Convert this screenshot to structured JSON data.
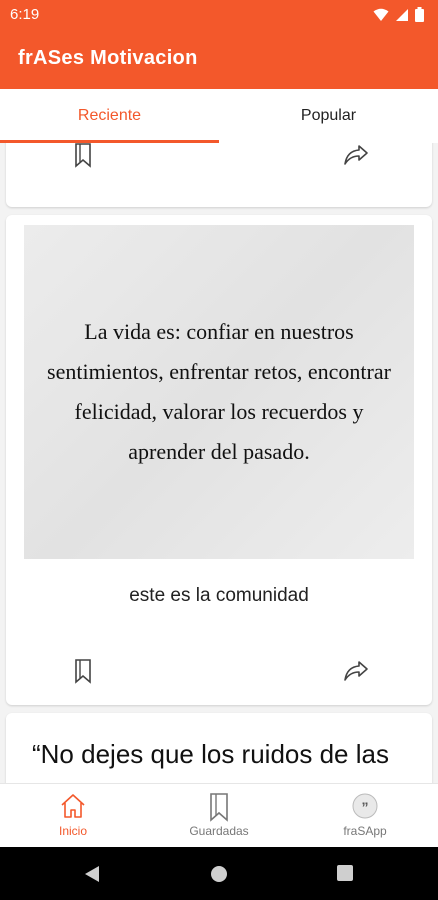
{
  "status": {
    "time": "6:19"
  },
  "app": {
    "title": "frASes Motivacion"
  },
  "tabs": [
    {
      "label": "Reciente"
    },
    {
      "label": "Popular"
    }
  ],
  "cards": [
    {
      "quote_text": "La vida es: confiar en nuestros sentimientos, enfrentar retos, encontrar felicidad, valorar los recuerdos y aprender del pasado.",
      "caption": "este es la comunidad"
    },
    {
      "quote_text": "“No dejes que los ruidos de las"
    }
  ],
  "bottom_nav": [
    {
      "label": "Inicio",
      "icon": "home-icon"
    },
    {
      "label": "Guardadas",
      "icon": "bookmark-icon"
    },
    {
      "label": "fraSApp",
      "icon": "quote-icon"
    }
  ],
  "colors": {
    "accent": "#f3582b"
  }
}
